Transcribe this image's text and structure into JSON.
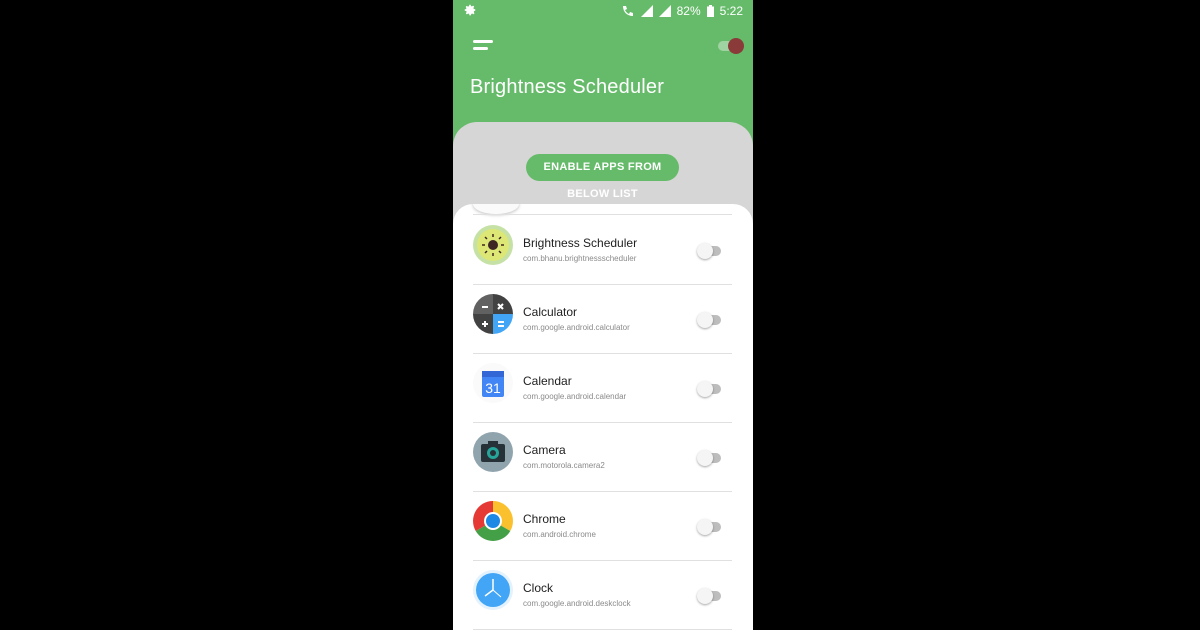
{
  "status_bar": {
    "battery": "82%",
    "time": "5:22",
    "icons": [
      "settings-gear-icon",
      "lte-call-icon",
      "signal-icon",
      "signal-icon",
      "battery-icon"
    ]
  },
  "header": {
    "title": "Brightness Scheduler",
    "menu_icon": "menu-icon",
    "master_toggle": "on"
  },
  "enable_button_label": "ENABLE APPS FROM BELOW LIST",
  "apps": [
    {
      "name": "Brightness Scheduler",
      "package": "com.bhanu.brightnessscheduler",
      "icon": "brightness-scheduler-icon",
      "enabled": false
    },
    {
      "name": "Calculator",
      "package": "com.google.android.calculator",
      "icon": "calculator-icon",
      "enabled": false
    },
    {
      "name": "Calendar",
      "package": "com.google.android.calendar",
      "icon": "calendar-icon",
      "enabled": false,
      "icon_text": "31"
    },
    {
      "name": "Camera",
      "package": "com.motorola.camera2",
      "icon": "camera-icon",
      "enabled": false
    },
    {
      "name": "Chrome",
      "package": "com.android.chrome",
      "icon": "chrome-icon",
      "enabled": false
    },
    {
      "name": "Clock",
      "package": "com.google.android.deskclock",
      "icon": "clock-icon",
      "enabled": false
    }
  ],
  "colors": {
    "primary_green": "#66bb6a",
    "background_gray": "#d6d6d6"
  }
}
